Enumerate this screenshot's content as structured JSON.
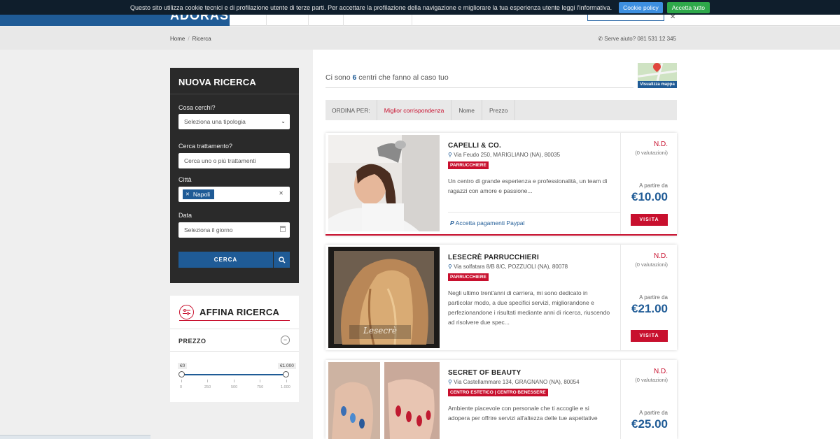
{
  "cookie": {
    "text": "Questo sito utilizza cookie tecnici e di profilazione utente di terze parti. Per accettare la profilazione della navigazione e migliorare la tua esperienza utente leggi l'informativa.",
    "policy_label": "Cookie policy",
    "accept_label": "Accetta tutto"
  },
  "header": {
    "logo": "ADORAS"
  },
  "breadcrumb": {
    "home": "Home",
    "sep": "/",
    "current": "Ricerca"
  },
  "help": {
    "text": "Serve aiuto? 081 531 12 345"
  },
  "search": {
    "title": "NUOVA RICERCA",
    "what_label": "Cosa cerchi?",
    "what_value": "Seleziona una tipologia",
    "treatment_label": "Cerca trattamento?",
    "treatment_placeholder": "Cerca uno o più trattamenti",
    "city_label": "Città",
    "city_tag": "Napoli",
    "date_label": "Data",
    "date_placeholder": "Seleziona il giorno",
    "button_label": "CERCA"
  },
  "filters": {
    "title": "AFFINA RICERCA",
    "price_label": "PREZZO",
    "min_label": "€0",
    "max_label": "€1.000",
    "range": [
      0,
      1000
    ],
    "scale": [
      "0",
      "250",
      "500",
      "750",
      "1.000"
    ]
  },
  "results": {
    "prefix": "Ci sono",
    "count": "6",
    "suffix": "centri che fanno al caso tuo",
    "map_label": "Visualizza mappa"
  },
  "sort": {
    "label": "ORDINA PER:",
    "options": [
      "Miglior corrispondenza",
      "Nome",
      "Prezzo"
    ],
    "active": "Miglior corrispondenza"
  },
  "cards": [
    {
      "name": "CAPELLI & CO.",
      "address": "Via Feudo 250, MARIGLIANO (NA), 80035",
      "category": "PARRUCCHIERE",
      "description": "Un centro di grande esperienza e professionalità, un team di ragazzi con amore e passione...",
      "rating": "N.D.",
      "reviews": "(0 valutazioni)",
      "from_label": "A partire da",
      "price": "€10.00",
      "visit_label": "VISITA",
      "paypal": "Accetta pagamenti Paypal"
    },
    {
      "name": "LESECRÈ PARRUCCHIERI",
      "address": "Via solfatara 8/B 8/C, POZZUOLI (NA), 80078",
      "category": "PARRUCCHIERE",
      "description": "Negli ultimo trent'anni di carriera, mi sono dedicato in particolar modo, a due specifici servizi, migliorandone e perfezionandone i risultati mediante anni di ricerca, riuscendo ad risolvere due spec...",
      "rating": "N.D.",
      "reviews": "(0 valutazioni)",
      "from_label": "A partire da",
      "price": "€21.00",
      "visit_label": "VISITA",
      "image_caption": "Lesecrè"
    },
    {
      "name": "SECRET OF BEAUTY",
      "address": "Via Castellammare 134, GRAGNANO (NA), 80054",
      "category": "CENTRO ESTETICO | CENTRO BENESSERE",
      "description": "Ambiente piacevole con personale che ti accoglie e si adopera per offrire servizi all'altezza delle tue aspettative",
      "rating": "N.D.",
      "reviews": "(0 valutazioni)",
      "from_label": "A partire da",
      "price": "€25.00"
    }
  ],
  "colors": {
    "brand_blue": "#1f5b96",
    "accent_red": "#c8102e",
    "panel_dark": "#2a2a2a"
  }
}
